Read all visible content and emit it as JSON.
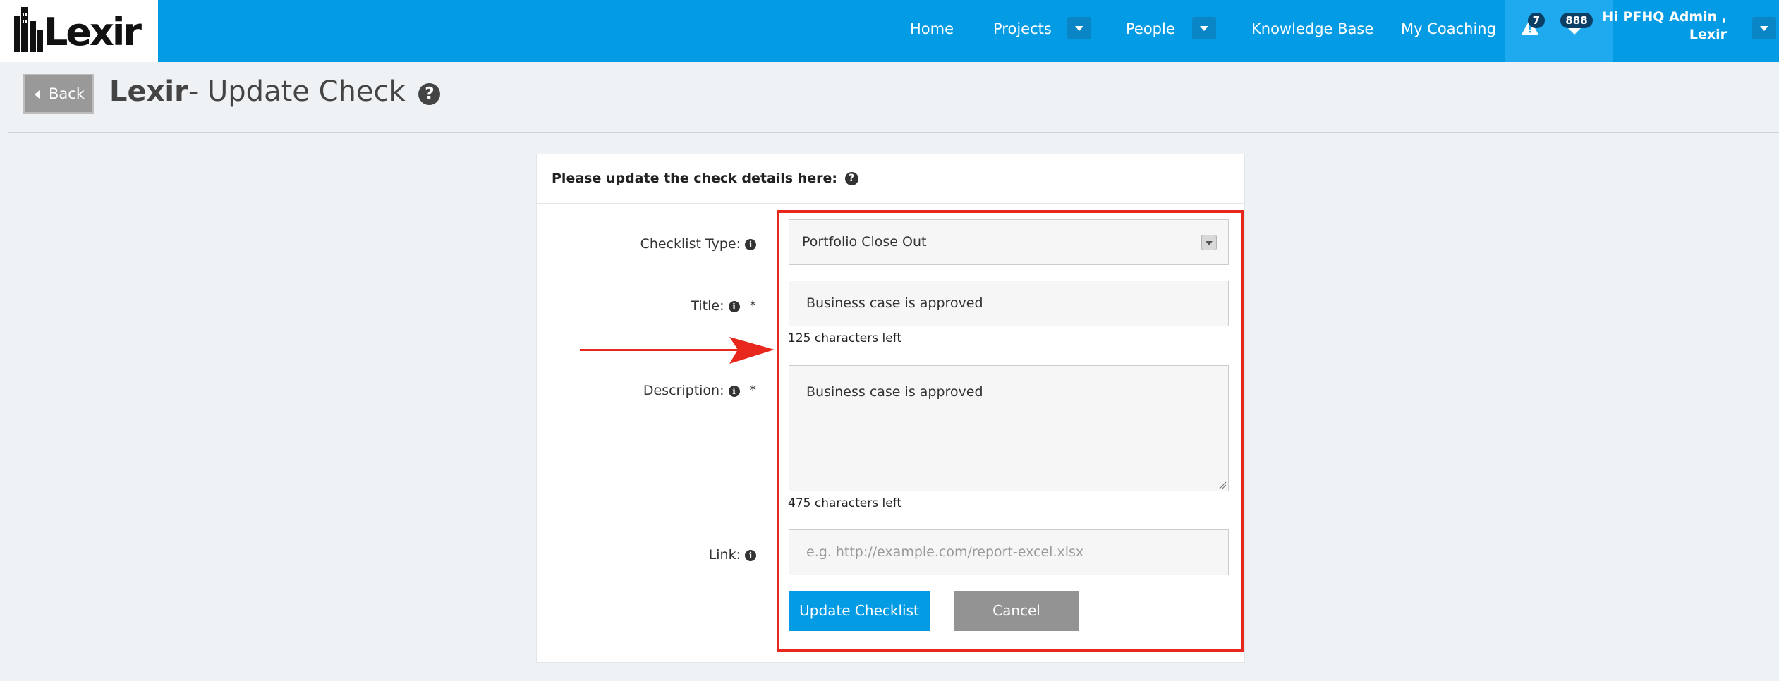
{
  "nav": {
    "logo_text": "Lexir",
    "links": [
      "Home",
      "Projects",
      "People",
      "Knowledge Base",
      "My Coaching"
    ],
    "alerts_count": "7",
    "messages_count": "888",
    "user_greeting_line1": "Hi PFHQ Admin ,",
    "user_greeting_line2": "Lexir"
  },
  "header": {
    "back_label": "Back",
    "title_bold": "Lexir",
    "title_rest": "- Update Check",
    "help_icon_glyph": "?"
  },
  "form": {
    "panel_title": "Please update the check details here:",
    "checklist_type_label": "Checklist Type:",
    "checklist_type_value": "Portfolio Close Out",
    "title_label": "Title:",
    "title_value": "Business case is approved",
    "title_chars_left": "125 characters left",
    "description_label": "Description:",
    "description_value": "Business case is approved",
    "description_chars_left": "475 characters left",
    "link_label": "Link:",
    "link_placeholder": "e.g. http://example.com/report-excel.xlsx",
    "required_mark": "*",
    "info_glyph": "i",
    "update_button": "Update Checklist",
    "cancel_button": "Cancel"
  },
  "colors": {
    "nav_blue": "#049be5",
    "highlight_red": "#e8281d",
    "arrow_red": "#e8281d",
    "cancel_gray": "#939393"
  },
  "icons": [
    "logo-buildings-icon",
    "caret-down-icon",
    "alert-triangle-icon",
    "heart-icon",
    "back-arrow-icon",
    "question-circle-icon",
    "info-circle-icon",
    "select-caret-icon",
    "resize-grip-icon",
    "annotation-arrow-icon"
  ]
}
